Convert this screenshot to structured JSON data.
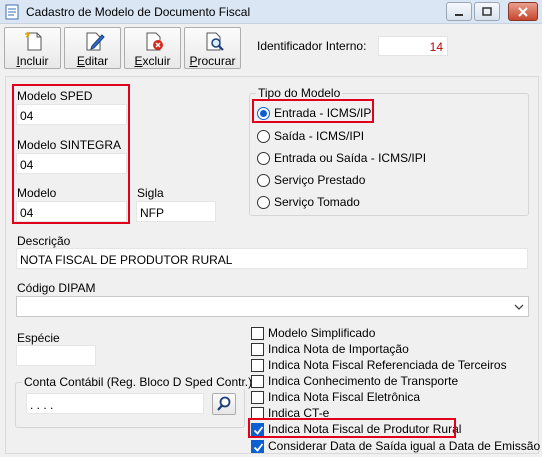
{
  "window": {
    "title": "Cadastro de Modelo de Documento Fiscal"
  },
  "toolbar": {
    "buttons": [
      {
        "label": "Incluir",
        "accel": "I",
        "rest": "ncluir"
      },
      {
        "label": "Editar",
        "accel": "E",
        "rest": "ditar"
      },
      {
        "label": "Excluir",
        "accel": "E",
        "rest": "xcluir"
      },
      {
        "label": "Procurar",
        "accel": "P",
        "rest": "rocurar"
      }
    ],
    "identifier_label": "Identificador Interno:",
    "identifier_value": "14"
  },
  "form": {
    "modelo_sped": {
      "label": "Modelo SPED",
      "value": "04"
    },
    "modelo_sintegra": {
      "label": "Modelo SINTEGRA",
      "value": "04"
    },
    "modelo": {
      "label": "Modelo",
      "value": "04"
    },
    "sigla": {
      "label": "Sigla",
      "value": "NFP"
    },
    "descricao": {
      "label": "Descrição",
      "value": "NOTA FISCAL DE PRODUTOR RURAL"
    },
    "codigo_dipam": {
      "label": "Código DIPAM",
      "value": ""
    },
    "especie": {
      "label": "Espécie",
      "value": ""
    },
    "conta_contabil": {
      "label": "Conta Contábil (Reg. Bloco D Sped Contr.)",
      "value": ". . . ."
    }
  },
  "tipo_modelo": {
    "title": "Tipo do Modelo",
    "options": [
      {
        "label": "Entrada - ICMS/IPI",
        "checked": true
      },
      {
        "label": "Saída - ICMS/IPI",
        "checked": false
      },
      {
        "label": "Entrada ou Saída - ICMS/IPI",
        "checked": false
      },
      {
        "label": "Serviço Prestado",
        "checked": false
      },
      {
        "label": "Serviço Tomado",
        "checked": false
      }
    ]
  },
  "checkboxes": [
    {
      "label": "Modelo Simplificado",
      "checked": false
    },
    {
      "label": "Indica Nota de Importação",
      "checked": false
    },
    {
      "label": "Indica Nota Fiscal Referenciada de Terceiros",
      "checked": false
    },
    {
      "label": "Indica Conhecimento de Transporte",
      "checked": false
    },
    {
      "label": "Indica Nota Fiscal Eletrônica",
      "checked": false
    },
    {
      "label": "Indica CT-e",
      "checked": false
    },
    {
      "label": "Indica Nota Fiscal de Produtor Rural",
      "checked": true
    },
    {
      "label": "Considerar Data de Saída igual a Data de Emissão",
      "checked": true
    }
  ],
  "colors": {
    "highlight": "#e0001b",
    "accent": "#0b5fd1",
    "identifier_text": "#c00000"
  }
}
